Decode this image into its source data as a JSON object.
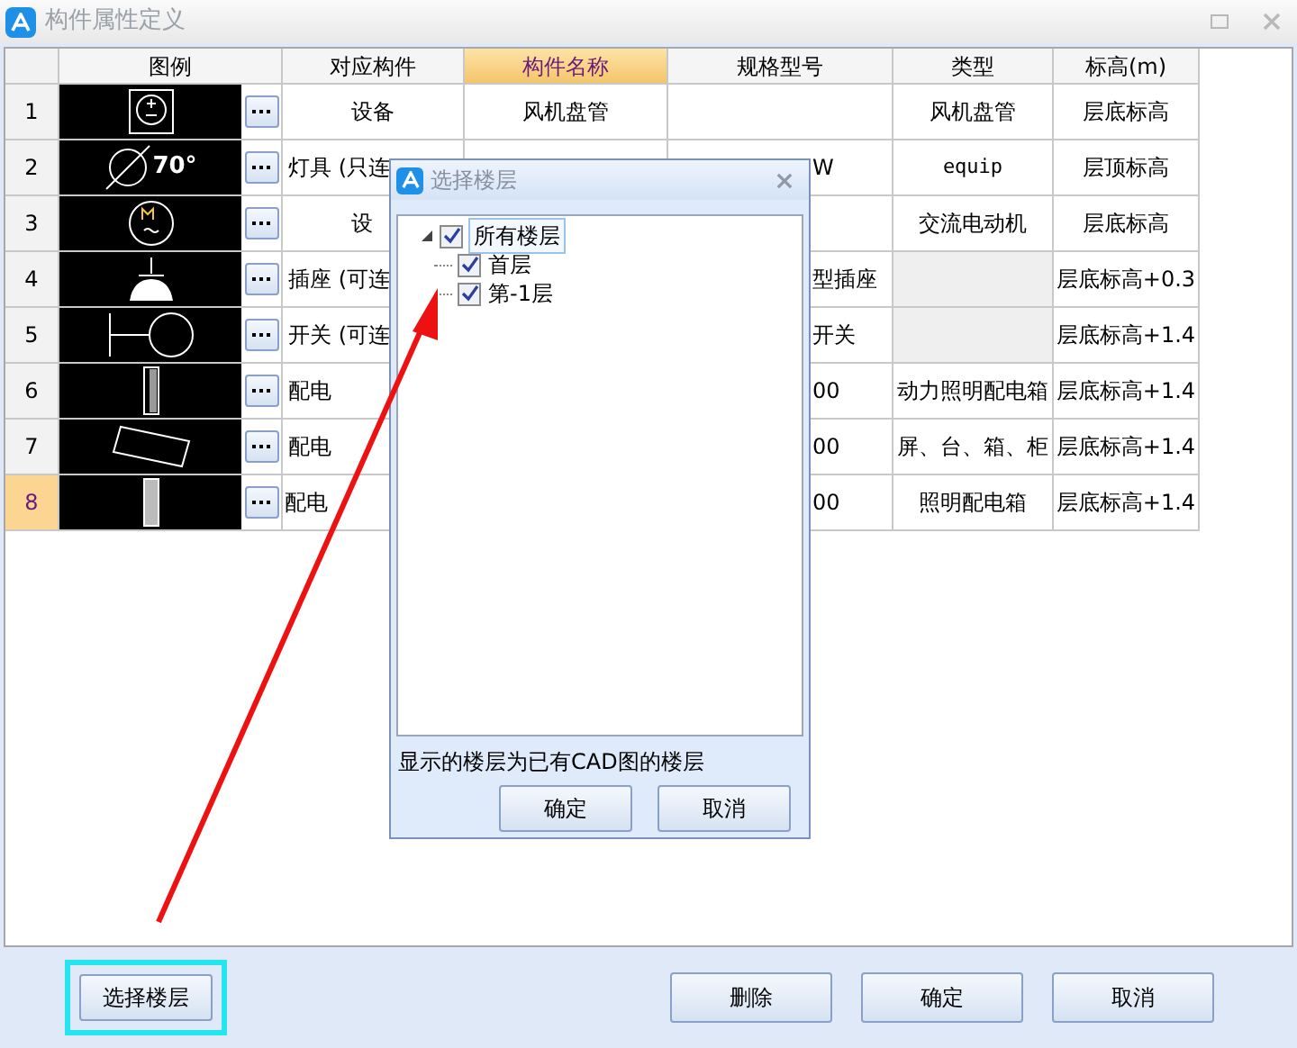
{
  "window": {
    "title": "构件属性定义"
  },
  "table": {
    "columns": [
      {
        "label": "图例",
        "selected": false
      },
      {
        "label": "对应构件",
        "selected": false
      },
      {
        "label": "构件名称",
        "selected": true
      },
      {
        "label": "规格型号",
        "selected": false
      },
      {
        "label": "类型",
        "selected": false
      },
      {
        "label": "标高(m)",
        "selected": false
      }
    ],
    "rows": [
      {
        "number": "1",
        "selected": false,
        "component": "设备",
        "name": "风机盘管",
        "type": "风机盘管",
        "type_disabled": false,
        "elevation": "层底标高"
      },
      {
        "number": "2",
        "selected": false,
        "legend_text": "70°",
        "component": "灯具 (只连",
        "spec": "W",
        "type": "equip",
        "type_disabled": false,
        "elevation": "层顶标高"
      },
      {
        "number": "3",
        "selected": false,
        "component": "设",
        "type": "交流电动机",
        "type_disabled": false,
        "elevation": "层底标高"
      },
      {
        "number": "4",
        "selected": false,
        "component": "插座 (可连",
        "spec": "型插座",
        "type_disabled": true,
        "elevation": "层底标高+0.3"
      },
      {
        "number": "5",
        "selected": false,
        "component": "开关 (可连",
        "spec": "开关",
        "type_disabled": true,
        "elevation": "层底标高+1.4"
      },
      {
        "number": "6",
        "selected": false,
        "component": "配电",
        "spec": "00",
        "type": "动力照明配电箱",
        "type_disabled": false,
        "elevation": "层底标高+1.4"
      },
      {
        "number": "7",
        "selected": false,
        "component": "配电",
        "spec": "00",
        "type": "屏、台、箱、柜",
        "type_disabled": false,
        "elevation": "层底标高+1.4"
      },
      {
        "number": "8",
        "selected": true,
        "component": "配电",
        "spec": "00",
        "type": "照明配电箱",
        "type_disabled": false,
        "elevation": "层底标高+1.4"
      }
    ]
  },
  "dialog": {
    "title": "选择楼层",
    "tree": [
      {
        "label": "所有楼层",
        "checked": true,
        "expanded": true,
        "selected": true,
        "children": [
          {
            "label": "首层",
            "checked": true,
            "selected": false
          },
          {
            "label": "第-1层",
            "checked": true,
            "selected": false
          }
        ]
      }
    ],
    "note": "显示的楼层为已有CAD图的楼层",
    "buttons": [
      "确定",
      "取消"
    ]
  },
  "footer": {
    "select_floor_button": {
      "label": "选择楼层",
      "highlighted": true
    },
    "buttons": [
      "删除",
      "确定",
      "取消"
    ]
  }
}
